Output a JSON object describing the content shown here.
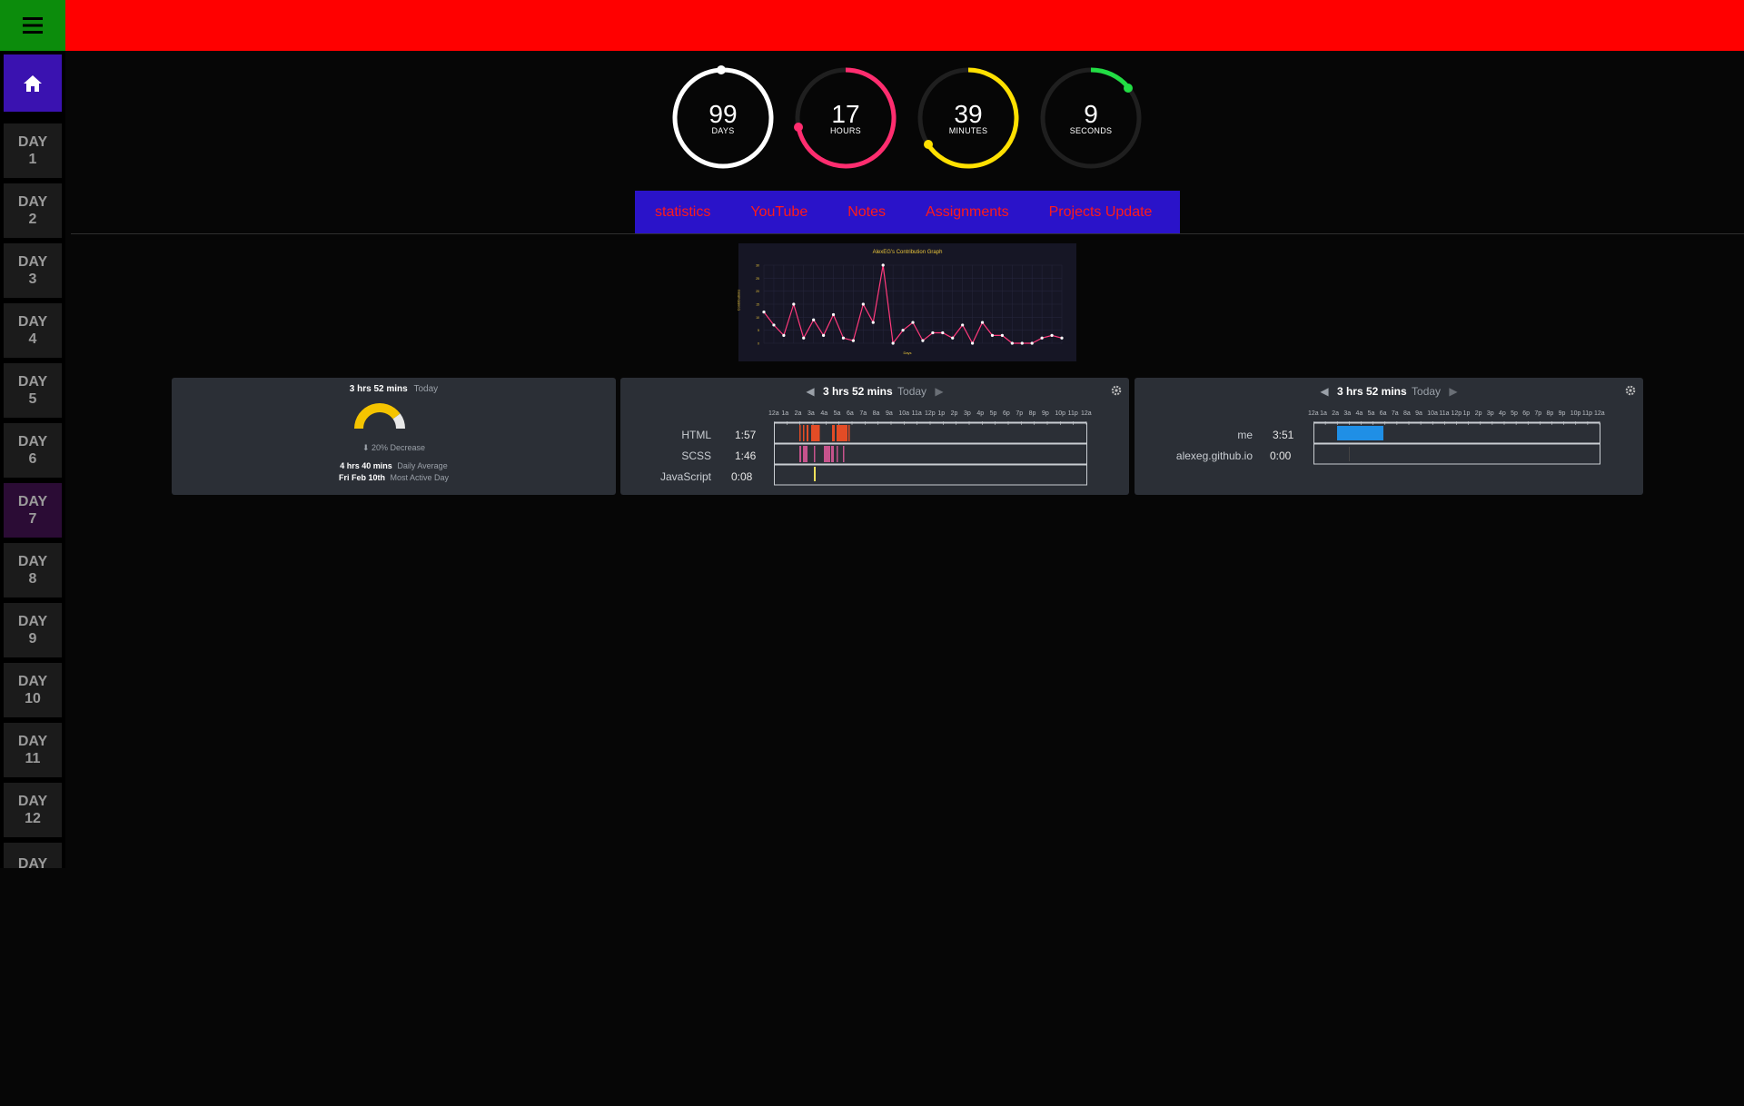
{
  "topbar": {
    "menu_icon": "hamburger-icon",
    "home_icon": "home-icon"
  },
  "sidebar": {
    "days": [
      {
        "label": "DAY",
        "num": "1"
      },
      {
        "label": "DAY",
        "num": "2"
      },
      {
        "label": "DAY",
        "num": "3"
      },
      {
        "label": "DAY",
        "num": "4"
      },
      {
        "label": "DAY",
        "num": "5"
      },
      {
        "label": "DAY",
        "num": "6"
      },
      {
        "label": "DAY",
        "num": "7"
      },
      {
        "label": "DAY",
        "num": "8"
      },
      {
        "label": "DAY",
        "num": "9"
      },
      {
        "label": "DAY",
        "num": "10"
      },
      {
        "label": "DAY",
        "num": "11"
      },
      {
        "label": "DAY",
        "num": "12"
      },
      {
        "label": "DAY",
        "num": ""
      }
    ]
  },
  "countdown": {
    "days": {
      "value": "99",
      "unit": "DAYS",
      "color": "#ffffff"
    },
    "hours": {
      "value": "17",
      "unit": "HOURS",
      "color": "#ff2d6f"
    },
    "minutes": {
      "value": "39",
      "unit": "MINUTES",
      "color": "#ffe000"
    },
    "seconds": {
      "value": "9",
      "unit": "SECONDS",
      "color": "#22dd44"
    }
  },
  "nav": {
    "items": [
      "statistics",
      "YouTube",
      "Notes",
      "Assignments",
      "Projects Update"
    ]
  },
  "contribution_chart": {
    "title": "AlexEG's Contribution Graph",
    "xlabel": "Days",
    "ylabel": "Contributions"
  },
  "chart_data": {
    "type": "line",
    "title": "AlexEG's Contribution Graph",
    "xlabel": "Days",
    "ylabel": "Contributions",
    "ylim": [
      0,
      30
    ],
    "values": [
      12,
      7,
      3,
      15,
      2,
      9,
      3,
      11,
      2,
      1,
      15,
      8,
      30,
      0,
      5,
      8,
      1,
      4,
      4,
      2,
      7,
      0,
      8,
      3,
      3,
      0,
      0,
      0,
      2,
      3,
      2
    ]
  },
  "wakatime_summary": {
    "today_time": "3 hrs 52 mins",
    "today_label": "Today",
    "change": "20% Decrease",
    "average_time": "4 hrs 40 mins",
    "average_label": "Daily Average",
    "active_day": "Fri Feb 10th",
    "active_label": "Most Active Day",
    "gauge_fraction": 0.8
  },
  "languages": {
    "header_time": "3 hrs 52 mins",
    "header_label": "Today",
    "hours": [
      "12a",
      "1a",
      "2a",
      "3a",
      "4a",
      "5a",
      "6a",
      "7a",
      "8a",
      "9a",
      "10a",
      "11a",
      "12p",
      "1p",
      "2p",
      "3p",
      "4p",
      "5p",
      "6p",
      "7p",
      "8p",
      "9p",
      "10p",
      "11p",
      "12a"
    ],
    "rows": [
      {
        "name": "HTML",
        "time": "1:57",
        "color": "#e34c26"
      },
      {
        "name": "SCSS",
        "time": "1:46",
        "color": "#c6538c"
      },
      {
        "name": "JavaScript",
        "time": "0:08",
        "color": "#f1e05a"
      }
    ]
  },
  "projects": {
    "header_time": "3 hrs 52 mins",
    "header_label": "Today",
    "rows": [
      {
        "name": "me",
        "time": "3:51",
        "color": "#1f8fe6"
      },
      {
        "name": "alexeg.github.io",
        "time": "0:00",
        "color": "#444444"
      }
    ]
  }
}
